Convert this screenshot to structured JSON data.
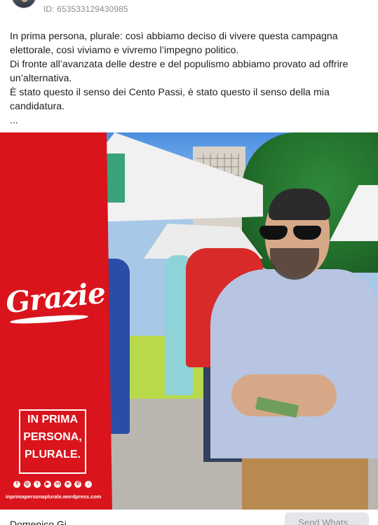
{
  "header": {
    "post_id": "ID: 653533129430985"
  },
  "post": {
    "paragraphs": [
      "In prima persona, plurale: così abbiamo deciso di vivere questa campagna elettorale, così viviamo e vivremo l’impegno politico.",
      "Di fronte all’avanzata delle destre e del populismo abbiamo provato ad offrire un’alternativa.",
      "È stato questo il senso dei Cento Passi, è stato questo il senso della mia candidatura."
    ],
    "see_more": "..."
  },
  "image": {
    "grazie": "Grazie",
    "slogan_lines": [
      "IN PRIMA",
      "PERSONA,",
      "PLURALE."
    ],
    "social_icons": [
      "facebook-icon",
      "instagram-icon",
      "twitter-icon",
      "youtube-icon",
      "linkedin-icon",
      "telegram-icon",
      "whatsapp-icon",
      "tiktok-icon"
    ],
    "website": "inprimapersonaplurale.wordpress.com",
    "brand_color": "#d9141c"
  },
  "footer": {
    "name": "Domenico Gi...",
    "send_button": "Send Whats..."
  }
}
